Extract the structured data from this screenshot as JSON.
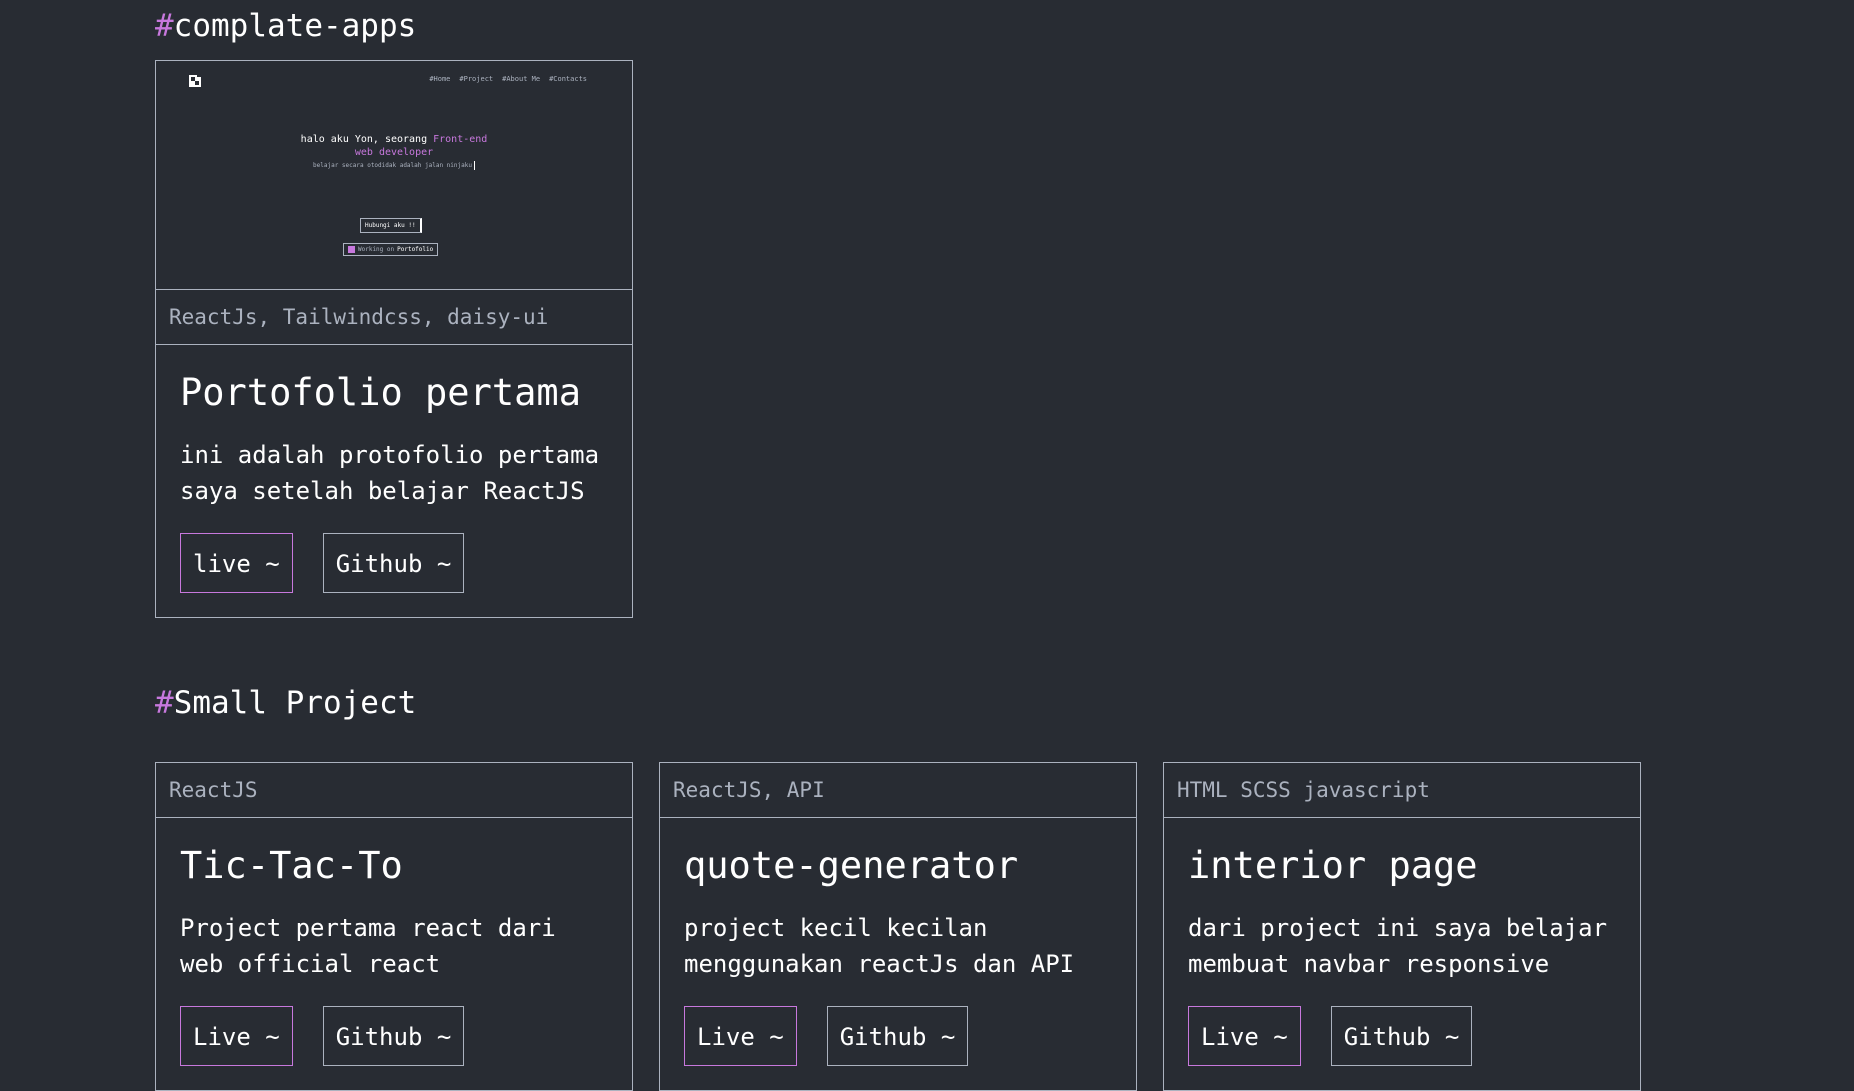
{
  "sections": {
    "complete": {
      "hash": "#",
      "label": "complate-apps"
    },
    "small": {
      "hash": "#",
      "label": "Small Project"
    }
  },
  "colors": {
    "background": "#282c33",
    "accent": "#c778dd",
    "border": "#abb2bf",
    "text": "#ffffff"
  },
  "complete_project": {
    "preview": {
      "nav": [
        "#Home",
        "#Project",
        "#About Me",
        "#Contacts"
      ],
      "hero_line1": "halo aku Yon, seorang ",
      "hero_accent1": "Front-end",
      "hero_accent2": "web developer",
      "subtitle": "belajar secara otodidak adalah jalan ninjaku",
      "button": "Hubungi aku !!",
      "status_prefix": "Working on ",
      "status_bold": "Portofolio",
      "logo_icon": "logo-icon"
    },
    "tags": "ReactJs, Tailwindcss, daisy-ui",
    "title": "Portofolio pertama",
    "description": "ini adalah protofolio pertama saya setelah belajar ReactJS",
    "live_label": "live ~",
    "github_label": "Github ~"
  },
  "small_projects": [
    {
      "tags": "ReactJS",
      "title": "Tic-Tac-To",
      "description": "Project pertama react dari web official react",
      "live_label": "Live ~",
      "github_label": "Github ~"
    },
    {
      "tags": "ReactJS, API",
      "title": "quote-generator",
      "description": "project kecil kecilan menggunakan reactJs dan API",
      "live_label": "Live ~",
      "github_label": "Github ~"
    },
    {
      "tags": "HTML SCSS javascript",
      "title": "interior page",
      "description": "dari project ini saya belajar membuat navbar responsive",
      "live_label": "Live ~",
      "github_label": "Github ~"
    }
  ]
}
